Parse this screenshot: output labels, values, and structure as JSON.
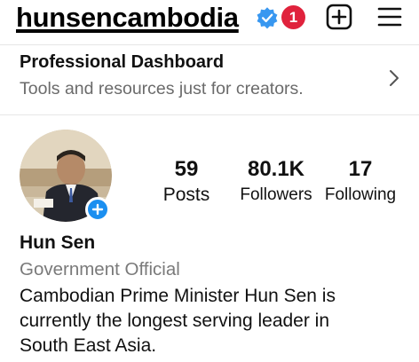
{
  "header": {
    "username": "hunsencambodia",
    "notification_count": "1",
    "icons": {
      "verified": "verified-badge-icon",
      "create": "plus-square-icon",
      "menu": "hamburger-menu-icon"
    },
    "colors": {
      "verified": "#3897f0",
      "notification": "#e0223c"
    }
  },
  "dashboard": {
    "title": "Professional Dashboard",
    "subtitle": "Tools and resources just for creators.",
    "icon": "chevron-right-icon"
  },
  "profile": {
    "add_story_icon": "plus-badge-icon",
    "stats": {
      "posts": {
        "value": "59",
        "label": "Posts"
      },
      "followers": {
        "value": "80.1K",
        "label": "Followers"
      },
      "following": {
        "value": "17",
        "label": "Following"
      }
    },
    "name": "Hun Sen",
    "category": "Government Official",
    "bio_lines": [
      "Cambodian Prime Minister Hun Sen is",
      "currently the longest serving leader in",
      "South East Asia."
    ]
  }
}
